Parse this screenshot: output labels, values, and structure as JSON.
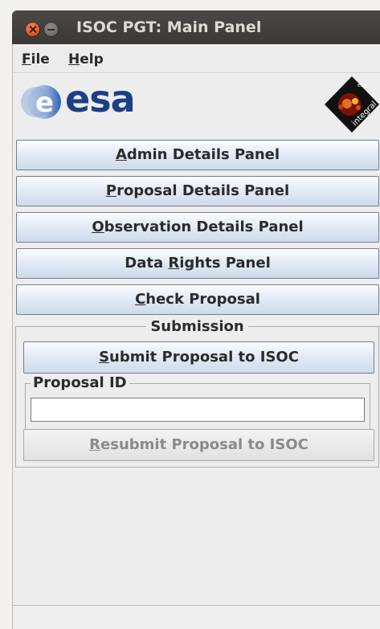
{
  "window": {
    "title": "ISOC PGT: Main Panel"
  },
  "menubar": {
    "items": [
      {
        "label_underlined": "F",
        "label_rest": "ile"
      },
      {
        "label_underlined": "H",
        "label_rest": "elp"
      }
    ]
  },
  "logos": {
    "left": "esa",
    "right_icon": "integral-mission-logo"
  },
  "panels": [
    {
      "pre": "",
      "u": "A",
      "post": "dmin Details Panel"
    },
    {
      "pre": "",
      "u": "P",
      "post": "roposal Details Panel"
    },
    {
      "pre": "",
      "u": "O",
      "post": "bservation Details Panel"
    },
    {
      "pre": "Data ",
      "u": "R",
      "post": "ights Panel"
    },
    {
      "pre": "",
      "u": "C",
      "post": "heck Proposal"
    }
  ],
  "submission": {
    "title": "Submission",
    "submit": {
      "pre": "",
      "u": "S",
      "post": "ubmit Proposal to ISOC"
    },
    "proposal_id_label": "Proposal ID",
    "proposal_id_value": "",
    "resubmit": {
      "pre": "",
      "u": "R",
      "post": "esubmit Proposal to ISOC",
      "enabled": false
    }
  },
  "colors": {
    "esa_blue": "#1c3f86",
    "close_button": "#e2521d",
    "titlebar": "#3c3b37"
  }
}
